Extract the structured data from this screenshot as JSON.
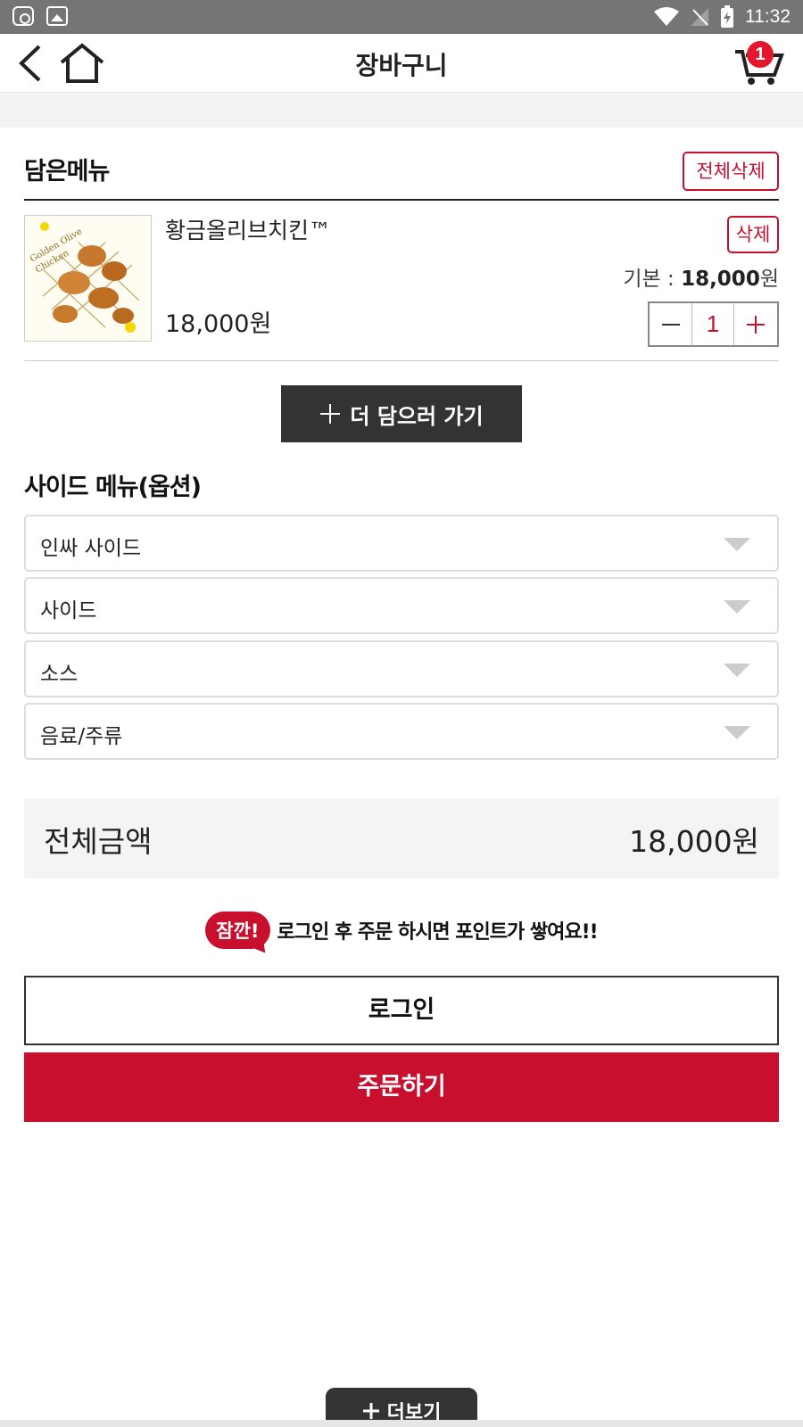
{
  "status_bar": {
    "time": "11:32",
    "icons": [
      "app-notification-icon",
      "photo-icon",
      "wifi-icon",
      "no-signal-icon",
      "battery-charging-icon"
    ]
  },
  "header": {
    "title": "장바구니",
    "cart_count": "1",
    "icons": [
      "back-arrow-icon",
      "home-icon",
      "cart-icon"
    ]
  },
  "cart": {
    "section_title": "담은메뉴",
    "delete_all_label": "전체삭제",
    "items": [
      {
        "name": "황금올리브치킨™",
        "price": "18,000원",
        "delete_label": "삭제",
        "base_label": "기본 : ",
        "base_price": "18,000",
        "base_unit": "원",
        "quantity": "1",
        "thumb_text": [
          "Golden Olive",
          "Chicken"
        ]
      }
    ],
    "add_more_label": "더 담으러 가기"
  },
  "side_menu": {
    "title": "사이드 메뉴(옵션)",
    "selects": [
      {
        "label": "인싸 사이드"
      },
      {
        "label": "사이드"
      },
      {
        "label": "소스"
      },
      {
        "label": "음료/주류"
      }
    ]
  },
  "total": {
    "label": "전체금액",
    "value": "18,000원"
  },
  "notice": {
    "badge": "잠깐!",
    "text": "로그인 후 주문 하시면 포인트가 쌓여요!!"
  },
  "actions": {
    "login_label": "로그인",
    "order_label": "주문하기",
    "more_label": "더보기"
  },
  "colors": {
    "brand_red": "#c8102e",
    "dark": "#333333",
    "status_bar": "#757575"
  }
}
